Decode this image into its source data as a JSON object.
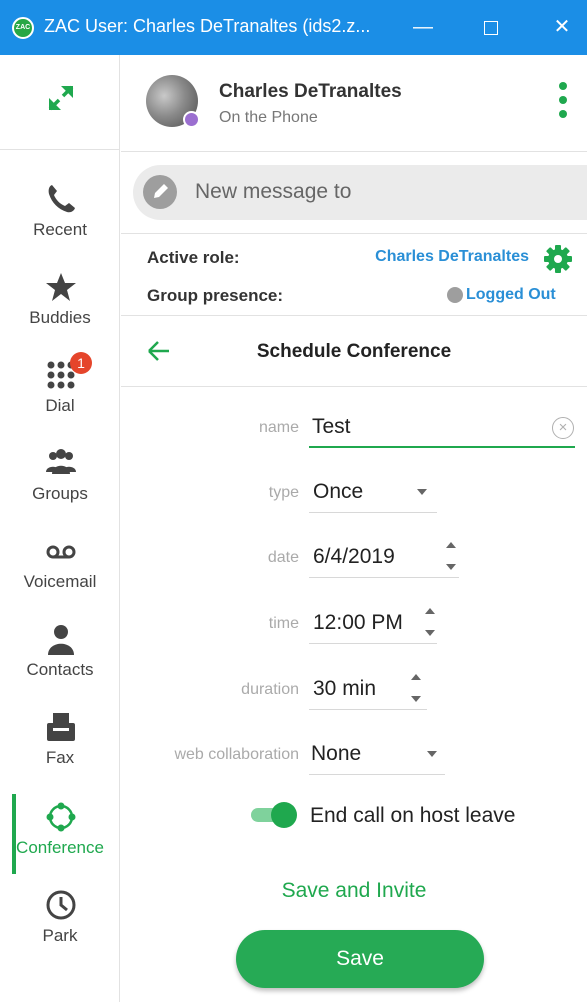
{
  "window": {
    "title": "ZAC User: Charles DeTranaltes (ids2.z...",
    "logo_text": "ZAC"
  },
  "sidebar": {
    "items": [
      {
        "label": "Recent",
        "icon": "phone-icon"
      },
      {
        "label": "Buddies",
        "icon": "star-icon"
      },
      {
        "label": "Dial",
        "icon": "dialpad-icon",
        "badge": "1"
      },
      {
        "label": "Groups",
        "icon": "groups-icon"
      },
      {
        "label": "Voicemail",
        "icon": "voicemail-icon"
      },
      {
        "label": "Contacts",
        "icon": "contact-icon"
      },
      {
        "label": "Fax",
        "icon": "fax-icon"
      },
      {
        "label": "Conference",
        "icon": "conference-icon",
        "active": true
      },
      {
        "label": "Park",
        "icon": "clock-icon"
      }
    ]
  },
  "header": {
    "user_name": "Charles DeTranaltes",
    "user_status": "On the Phone"
  },
  "message": {
    "placeholder": "New message to"
  },
  "role": {
    "active_role_label": "Active role:",
    "active_role_value": "Charles DeTranaltes",
    "group_presence_label": "Group presence:",
    "group_presence_value": "Logged Out"
  },
  "conference": {
    "title": "Schedule Conference",
    "fields": {
      "name": {
        "label": "name",
        "value": "Test"
      },
      "type": {
        "label": "type",
        "value": "Once"
      },
      "date": {
        "label": "date",
        "value": "6/4/2019"
      },
      "time": {
        "label": "time",
        "value": "12:00 PM"
      },
      "duration": {
        "label": "duration",
        "value": "30 min"
      },
      "web_collaboration": {
        "label": "web collaboration",
        "value": "None"
      }
    },
    "end_call_toggle": {
      "label": "End call on host leave",
      "on": true
    },
    "save_invite_label": "Save and Invite",
    "save_label": "Save"
  },
  "colors": {
    "accent_green": "#1fa84e",
    "title_bar_blue": "#1b8ee6",
    "link_blue": "#2a8fd6",
    "badge_red": "#e5452b"
  }
}
